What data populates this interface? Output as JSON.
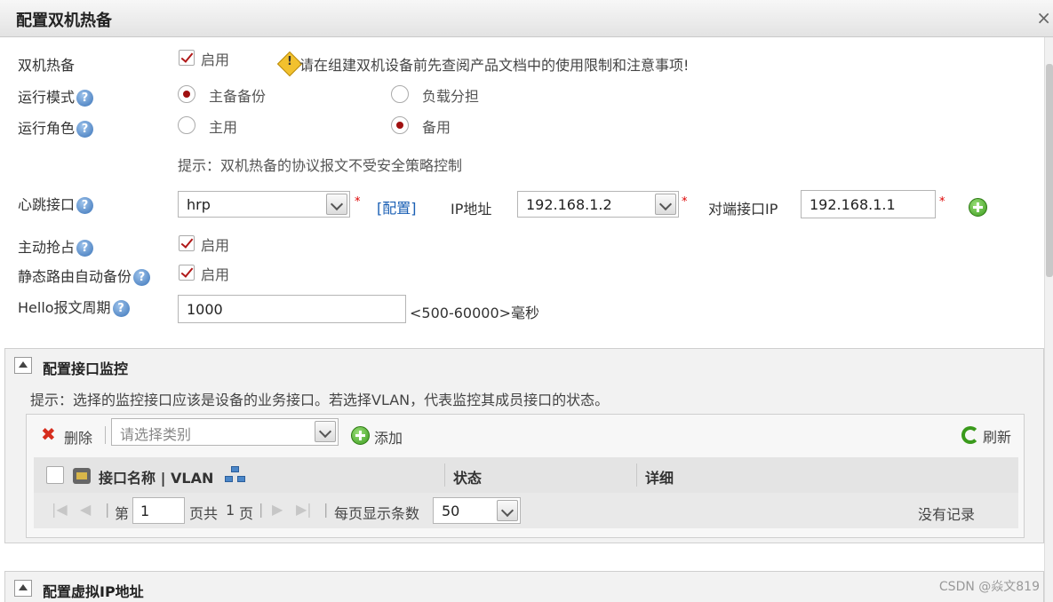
{
  "dialog": {
    "title": "配置双机热备",
    "close_icon": "×"
  },
  "hot_standby": {
    "label": "双机热备",
    "enable_label": "启用",
    "enabled": true,
    "warning": "请在组建双机设备前先查阅产品文档中的使用限制和注意事项!"
  },
  "run_mode": {
    "label": "运行模式",
    "options": [
      "主备备份",
      "负载分担"
    ],
    "selected": "主备备份"
  },
  "run_role": {
    "label": "运行角色",
    "options": [
      "主用",
      "备用"
    ],
    "selected": "备用"
  },
  "hint": "提示：双机热备的协议报文不受安全策略控制",
  "heartbeat": {
    "label": "心跳接口",
    "interface": "hrp",
    "config_link": "[配置]",
    "ip_label": "IP地址",
    "ip": "192.168.1.2",
    "peer_label": "对端接口IP",
    "peer_ip": "192.168.1.1",
    "required": "*"
  },
  "preempt": {
    "label": "主动抢占",
    "enable_label": "启用",
    "enabled": true
  },
  "static_route": {
    "label": "静态路由自动备份",
    "enable_label": "启用",
    "enabled": true
  },
  "hello": {
    "label": "Hello报文周期",
    "value": "1000",
    "range": "<500-60000>毫秒"
  },
  "help_icon": "?",
  "monitor": {
    "title": "配置接口监控",
    "tip": "提示：选择的监控接口应该是设备的业务接口。若选择VLAN，代表监控其成员接口的状态。",
    "delete_label": "删除",
    "category_placeholder": "请选择类别",
    "add_label": "添加",
    "refresh_label": "刷新",
    "columns": [
      "接口名称 | VLAN",
      "状态",
      "详细"
    ],
    "pager": {
      "page_prefix": "第",
      "page": "1",
      "page_suffix_a": "页共",
      "total": "1",
      "page_suffix_b": "页",
      "per_page_label": "每页显示条数",
      "per_page": "50",
      "empty": "没有记录"
    }
  },
  "virtual_ip": {
    "title": "配置虚拟IP地址"
  },
  "watermark": "CSDN @焱文819"
}
